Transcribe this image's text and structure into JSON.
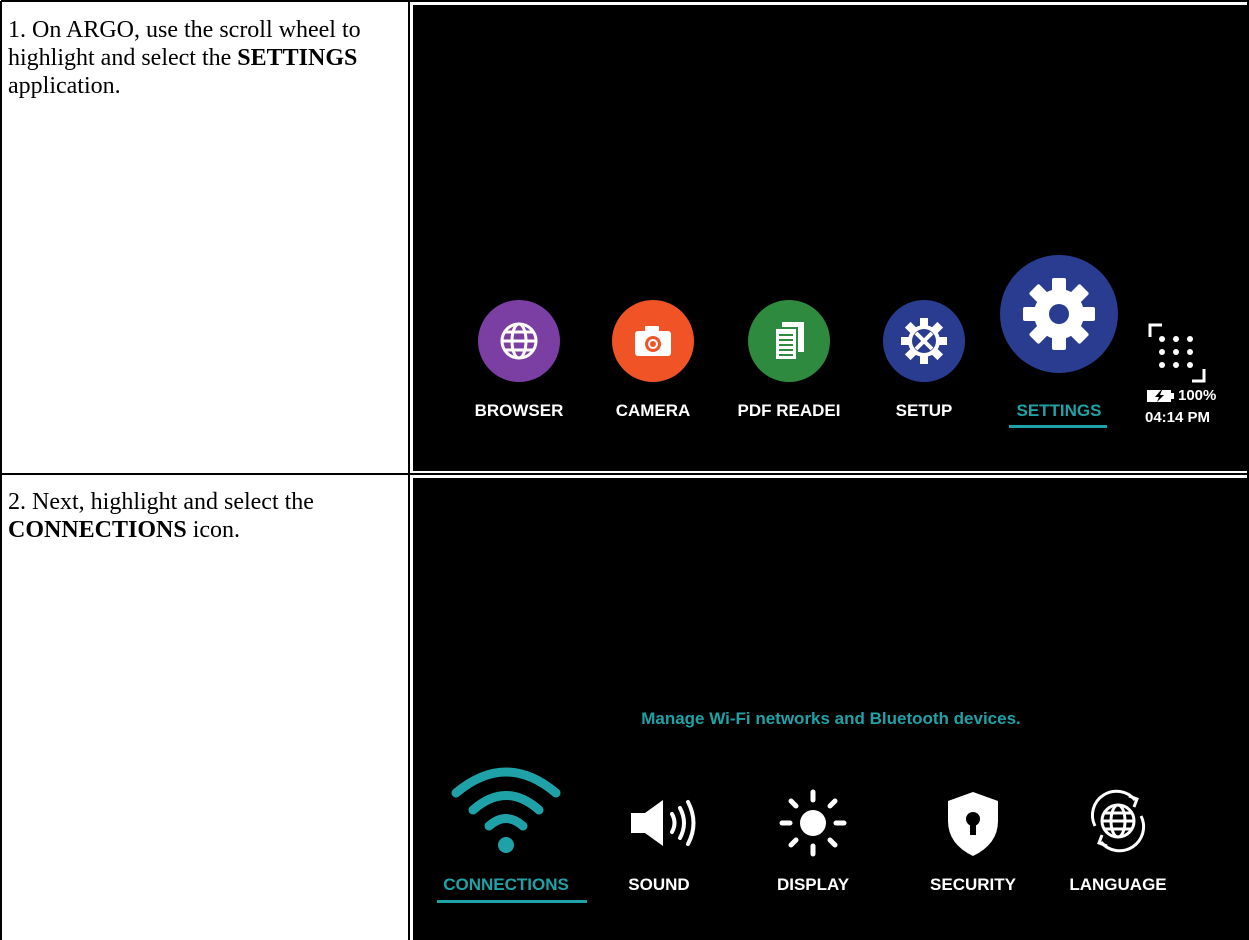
{
  "steps": [
    {
      "pre": "1. On ARGO, use the scroll wheel to highlight and select the ",
      "bold": "SETTINGS",
      "post": " application."
    },
    {
      "pre": "2. Next, highlight and select the ",
      "bold": "CONNECTIONS",
      "post": " icon."
    }
  ],
  "screen1": {
    "apps": [
      {
        "label": "BROWSER",
        "icon": "globe-icon",
        "color": "#7b3fa4"
      },
      {
        "label": "CAMERA",
        "icon": "camera-icon",
        "color": "#f05426"
      },
      {
        "label": "PDF READEI",
        "icon": "document-icon",
        "color": "#2e8a3f"
      },
      {
        "label": "SETUP",
        "icon": "wrench-gear-icon",
        "color": "#2a3c8f"
      },
      {
        "label": "SETTINGS",
        "icon": "gear-icon",
        "color": "#2a3c8f",
        "selected": true
      }
    ],
    "status": {
      "battery": "100%",
      "time": "04:14 PM",
      "icon": "keypad-icon"
    }
  },
  "screen2": {
    "hint": "Manage Wi-Fi networks and Bluetooth devices.",
    "items": [
      {
        "label": "CONNECTIONS",
        "icon": "wifi-icon",
        "selected": true
      },
      {
        "label": "SOUND",
        "icon": "speaker-icon"
      },
      {
        "label": "DISPLAY",
        "icon": "brightness-icon"
      },
      {
        "label": "SECURITY",
        "icon": "shield-lock-icon"
      },
      {
        "label": "LANGUAGE",
        "icon": "language-globe-icon"
      }
    ]
  },
  "colors": {
    "accent": "#1fa2a7",
    "screen_bg": "#000000"
  }
}
